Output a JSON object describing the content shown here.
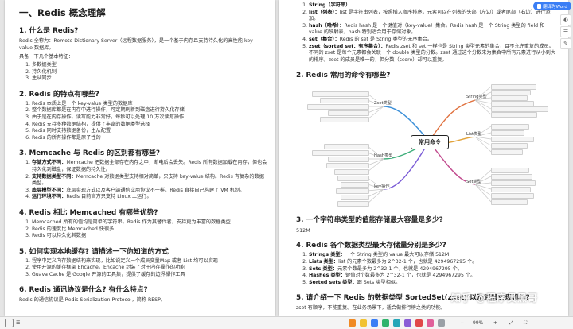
{
  "left": {
    "h1": "一、Redis 概念理解",
    "s1": {
      "title": "1. 什么是 Redis?",
      "p1": "Redis 全称为：Remote Dictionary Server（远程数据服务），是一个基于内存且支持持久化的高性能 key-value 数据库。",
      "p2": "具备一下几个基本特征：",
      "items": [
        "多数据类型",
        "持久化机制",
        "主从同步"
      ]
    },
    "s2": {
      "title": "2. Redis 的特点有哪些?",
      "items": [
        "Redis 本质上是一个 key-value 类型的数据库",
        "整个数据库都是在内存中进行操作，可定期刷新到磁盘进行持久化存储",
        "由于是在内存操作，读写能力非常好，每秒可以处理 10 万次读写操作",
        "Redis 支持多种数据结构，提供了丰富的数据类型选择",
        "Redis 同时支持数据备份，主从配置",
        "Redis 的所有操作都是原子性的"
      ]
    },
    "s3": {
      "title": "3. Memcache 与 Redis 的区别都有哪些?",
      "items": [
        {
          "b": "存储方式不同：",
          "t": "Memcache 把数据全部存在内存之中，断电后会丢失。Redis 所有数据加载在内存，但也会持久化到磁盘，保证数据的持久性。"
        },
        {
          "b": "支持数据类型不同：",
          "t": "Memcache 对数据类型支持相对简单，只支持 key-value 结构。Redis 有复杂的数据类型。"
        },
        {
          "b": "底层模型不同：",
          "t": "底层实现方式以及客户端通信应用协议不一样。Redis 直接自己构建了 VM 机制。"
        },
        {
          "b": "运行环境不同：",
          "t": "Redis 目前官方只支持 Linux 上运行。"
        }
      ]
    },
    "s4": {
      "title": "4. Redis 相比 Memcached 有哪些优势?",
      "items": [
        "Memcached 所有的值均是简单的字符串，Redis 作为其替代者，支持更为丰富的数据类型",
        "Redis 的速度比 Memcached 快很多",
        "Redis 可以持久化其数据"
      ]
    },
    "s5": {
      "title": "5. 如何实现本地缓存? 请描述一下你知道的方式",
      "items": [
        "程序中定义内存数据结构来实现，比如说定义一个成员变量Map 或者 List 均可以实现",
        "使用开源的缓存框架 Ehcache。Ehcache 封装了对于内存操作的功能",
        "Guava Cache 是 Google 开源的工具集，提供了缓存的边界操作工具"
      ]
    },
    "s6": {
      "title": "6. Redis 通讯协议是什么? 有什么特点?",
      "p1": "Redis 的通信协议是 Redis Serialization Protocol，简称 RESP。"
    }
  },
  "right": {
    "types": [
      {
        "b": "String（字符串）",
        "t": ""
      },
      {
        "b": "list（列表）：",
        "t": "list 是字符串列表，按照插入顺序排序。元素可以在列表的头部（左边）或者尾部（右边）进行添加。"
      },
      {
        "b": "hash（哈希）：",
        "t": "Redis hash 是一个键值对（key-value）集合。Redis hash 是一个 String 类型的 field 和 value 的映射表，hash 特别适合用于存储对象。"
      },
      {
        "b": "set（集合）：",
        "t": "Redis 的 set 是 String 类型的无序集合。"
      },
      {
        "b": "zset（sorted set：有序集合）：",
        "t": "Redis zset 和 set 一样也是 String 类型元素的集合，且不允许重复的成员。不同的 zset 是每个元素都会关联一个 double 类型的分数。zset 通过这个分数来为集合中所有元素进行从小到大的排序。zset 的成员是唯一的，但分数（score）却可以重复。"
      }
    ],
    "q2": "2. Redis 常用的命令有哪些?",
    "mindmap": {
      "center": "常用命令",
      "branches": [
        "String类型",
        "Zset类型",
        "List类型",
        "Hash类型",
        "Set类型",
        "key操作"
      ]
    },
    "q3": "3. 一个字符串类型的值能存储最大容量是多少?",
    "a3": "512M",
    "q4": "4. Redis 各个数据类型最大存储量分别是多少?",
    "limits": [
      {
        "b": "Strings 类型：",
        "t": "一个 String 类型的 value 最大可以存储 512M"
      },
      {
        "b": "Lists 类型：",
        "t": "list 的元素个数最多为 2^32-1 个，也就是 4294967295 个。"
      },
      {
        "b": "Sets 类型：",
        "t": "元素个数最多为 2^32-1 个，也就是 4294967295 个。"
      },
      {
        "b": "Hashes 类型：",
        "t": "键值对个数最多为 2^32-1 个，也就是 4294967295 个。"
      },
      {
        "b": "Sorted sets 类型：",
        "t": "跟 Sets 类型相似。"
      }
    ],
    "q5": "5. 请介绍一下 Redis 的数据类型 SortedSet(zset) 以及底层实现机制?",
    "p5": "zset 有顺序，不能重复。在业务场景下，适合做排行榜之类的功能。",
    "translate_label": "翻译为Word"
  },
  "status": {
    "zoom": "99%"
  },
  "watermark": "知乎 @程序员黑哥"
}
